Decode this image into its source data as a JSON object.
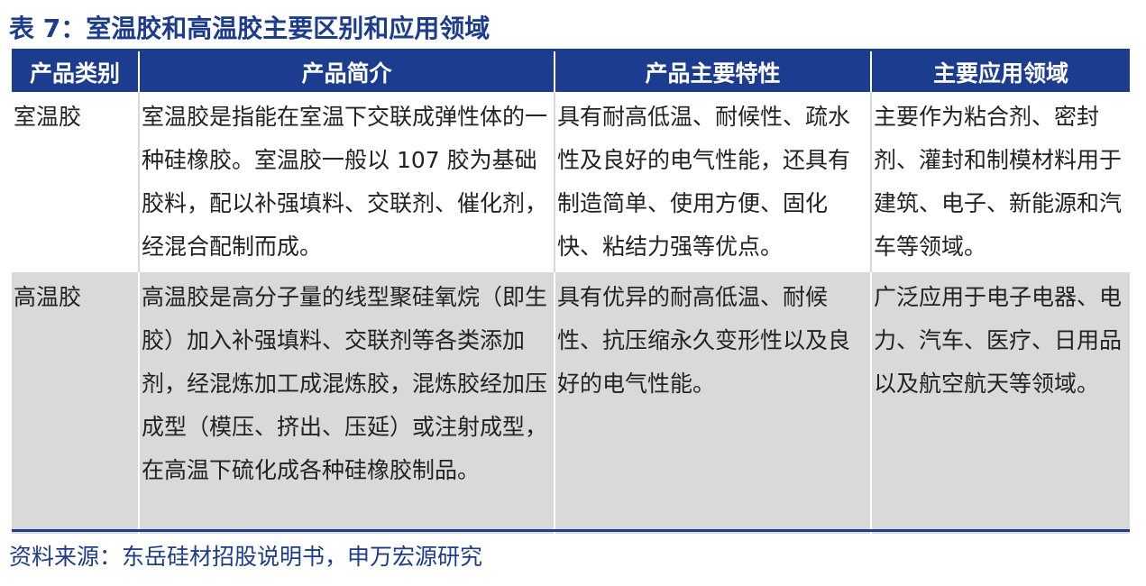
{
  "title": "表 7：室温胶和高温胶主要区别和应用领域",
  "headers": [
    "产品类别",
    "产品简介",
    "产品主要特性",
    "主要应用领域"
  ],
  "rows": [
    [
      "室温胶",
      "室温胶是指能在室温下交联成弹性体的一种硅橡胶。室温胶一般以 107 胶为基础胶料，配以补强填料、交联剂、催化剂，经混合配制而成。",
      "具有耐高低温、耐候性、疏水性及良好的电气性能，还具有制造简单、使用方便、固化快、粘结力强等优点。",
      "主要作为粘合剂、密封剂、灌封和制模材料用于建筑、电子、新能源和汽车等领域。"
    ],
    [
      "高温胶",
      "高温胶是高分子量的线型聚硅氧烷（即生胶）加入补强填料、交联剂等各类添加剂，经混炼加工成混炼胶，混炼胶经加压成型（模压、挤出、压延）或注射成型，在高温下硫化成各种硅橡胶制品。",
      "具有优异的耐高低温、耐候性、抗压缩永久变形性以及良好的电气性能。",
      "广泛应用于电子电器、电力、汽车、医疗、日用品以及航空航天等领域。"
    ]
  ],
  "source": "资料来源：东岳硅材招股说明书，申万宏源研究",
  "colors": {
    "header_bg": "#1b3c8f",
    "alt_row_bg": "#d9d9d9",
    "title": "#1b3c8f"
  }
}
